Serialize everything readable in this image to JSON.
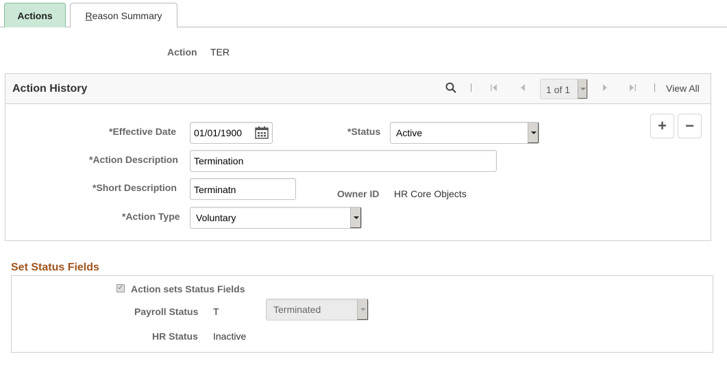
{
  "tabs": [
    {
      "label": "Actions",
      "active": true
    },
    {
      "label_accesskey": "R",
      "label_rest": "eason Summary",
      "active": false
    }
  ],
  "action": {
    "label": "Action",
    "value": "TER"
  },
  "action_history": {
    "title": "Action History",
    "pager": {
      "text": "1 of 1"
    },
    "view_all": "View All",
    "icons": {
      "search": "search-icon",
      "first": "first-page-icon",
      "prev": "previous-icon",
      "next": "next-icon",
      "last": "last-page-icon"
    },
    "fields": {
      "effective_date": {
        "label": "*Effective Date",
        "value": "01/01/1900"
      },
      "status": {
        "label": "*Status",
        "value": "Active"
      },
      "action_description": {
        "label": "*Action Description",
        "value": "Termination"
      },
      "short_description": {
        "label": "*Short Description",
        "value": "Terminatn"
      },
      "owner_id": {
        "label": "Owner ID",
        "value": "HR Core Objects"
      },
      "action_type": {
        "label": "*Action Type",
        "value": "Voluntary"
      }
    },
    "add_label": "+",
    "remove_label": "−"
  },
  "set_status": {
    "title": "Set Status Fields",
    "checkbox": {
      "label": "Action sets Status Fields",
      "checked": true
    },
    "payroll_status": {
      "label": "Payroll Status",
      "code": "T",
      "value": "Terminated"
    },
    "hr_status": {
      "label": "HR Status",
      "value": "Inactive"
    }
  }
}
